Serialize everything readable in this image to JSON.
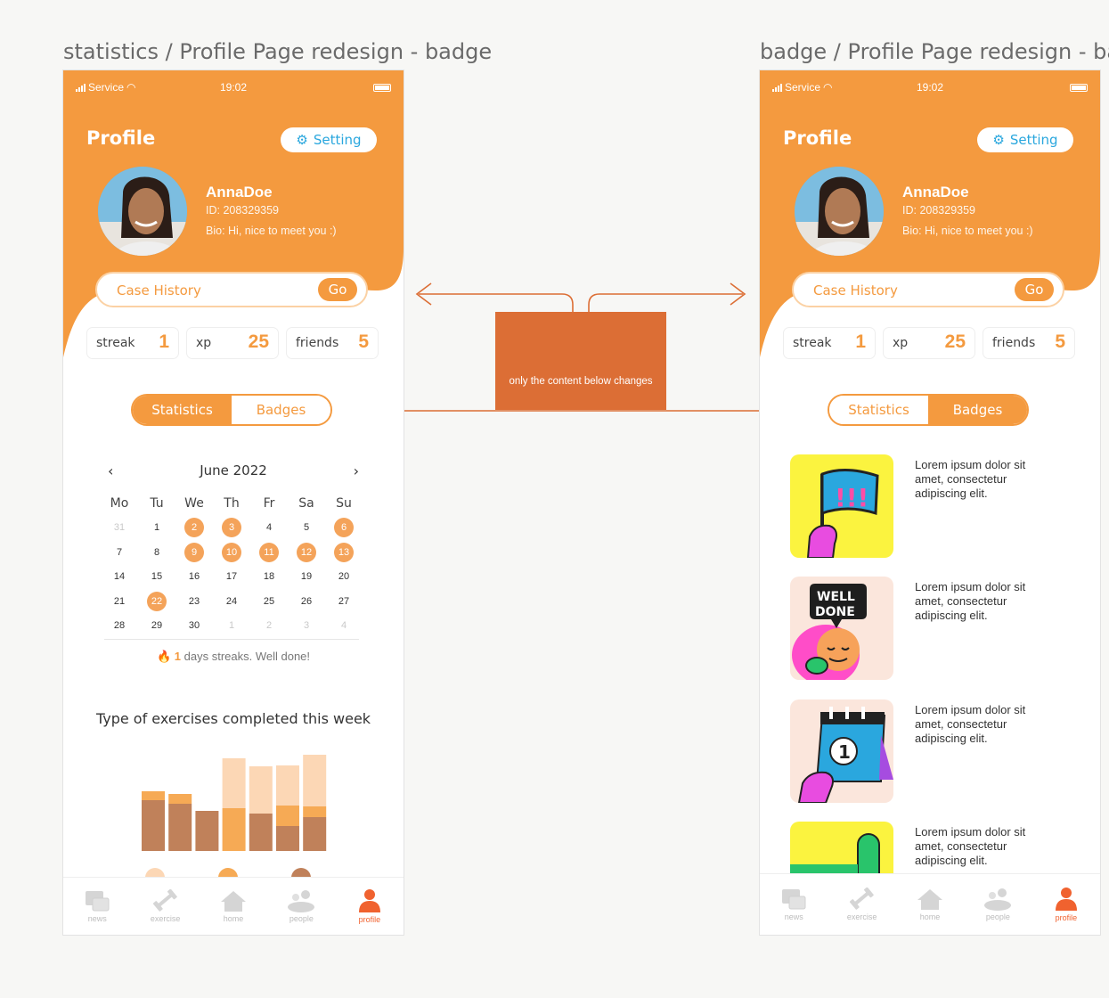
{
  "frames": [
    {
      "title": "statistics / Profile Page redesign - badge",
      "status": {
        "carrier": "Service",
        "time": "19:02"
      },
      "header": {
        "title": "Profile",
        "setting_label": "Setting"
      },
      "user": {
        "name": "AnnaDoe",
        "id": "ID: 208329359",
        "bio": "Bio: Hi, nice to meet you :)"
      },
      "case_history": {
        "label": "Case History",
        "go": "Go"
      },
      "stats": [
        {
          "label": "streak",
          "value": "1"
        },
        {
          "label": "xp",
          "value": "25"
        },
        {
          "label": "friends",
          "value": "5"
        }
      ],
      "tabs": {
        "statistics": "Statistics",
        "badges": "Badges",
        "active": "statistics"
      },
      "calendar": {
        "month": "June 2022",
        "weekdays": [
          "Mo",
          "Tu",
          "We",
          "Th",
          "Fr",
          "Sa",
          "Su"
        ],
        "weeks": [
          [
            "31",
            "1",
            "2",
            "3",
            "4",
            "5",
            "6"
          ],
          [
            "7",
            "8",
            "9",
            "10",
            "11",
            "12",
            "13"
          ],
          [
            "14",
            "15",
            "16",
            "17",
            "18",
            "19",
            "20"
          ],
          [
            "21",
            "22",
            "23",
            "24",
            "25",
            "26",
            "27"
          ],
          [
            "28",
            "29",
            "30",
            "1",
            "2",
            "3",
            "4"
          ]
        ],
        "highlighted": [
          "2",
          "3",
          "6",
          "9",
          "10",
          "11",
          "12",
          "13",
          "22"
        ],
        "streak_count": "1",
        "streak_text": "days streaks. Well done!"
      },
      "chart_title": "Type of exercises completed this week"
    },
    {
      "title": "badge / Profile Page redesign - badge",
      "status": {
        "carrier": "Service",
        "time": "19:02"
      },
      "header": {
        "title": "Profile",
        "setting_label": "Setting"
      },
      "user": {
        "name": "AnnaDoe",
        "id": "ID: 208329359",
        "bio": "Bio: Hi, nice to meet you :)"
      },
      "case_history": {
        "label": "Case History",
        "go": "Go"
      },
      "stats": [
        {
          "label": "streak",
          "value": "1"
        },
        {
          "label": "xp",
          "value": "25"
        },
        {
          "label": "friends",
          "value": "5"
        }
      ],
      "tabs": {
        "statistics": "Statistics",
        "badges": "Badges",
        "active": "badges"
      },
      "badges": [
        {
          "text": "Lorem ipsum dolor sit amet, consectetur adipiscing elit.",
          "icon": "flag-badge-icon"
        },
        {
          "text": "Lorem ipsum dolor sit amet, consectetur adipiscing elit.",
          "icon": "well-done-badge-icon"
        },
        {
          "text": "Lorem ipsum dolor sit amet, consectetur adipiscing elit.",
          "icon": "calendar-badge-icon"
        },
        {
          "text": "Lorem ipsum dolor sit amet, consectetur adipiscing elit.",
          "icon": "thumb-badge-icon"
        }
      ]
    }
  ],
  "nav": [
    "news",
    "exercise",
    "home",
    "people",
    "profile"
  ],
  "nav_active": "profile",
  "annotation": {
    "note": "only the content below changes"
  },
  "colors": {
    "brand_orange": "#f49a3f",
    "callout": "#dc6e35",
    "setting_blue": "#2aa7de",
    "profile_active": "#f0622f"
  },
  "chart_data": {
    "type": "bar",
    "stacked": true,
    "categories": [
      "",
      "",
      "",
      "",
      "",
      "",
      "",
      ""
    ],
    "series": [
      {
        "color": "#c0815a",
        "values": [
          57,
          53,
          45,
          0,
          42,
          28,
          38,
          0
        ]
      },
      {
        "color": "#f6aa55",
        "values": [
          10,
          11,
          0,
          48,
          0,
          23,
          12,
          0
        ]
      },
      {
        "color": "#fcd7b5",
        "values": [
          0,
          0,
          0,
          56,
          53,
          45,
          58,
          0
        ]
      }
    ],
    "legend": [
      "#fcd7b5",
      "#f6aa55",
      "#c0815a"
    ]
  }
}
